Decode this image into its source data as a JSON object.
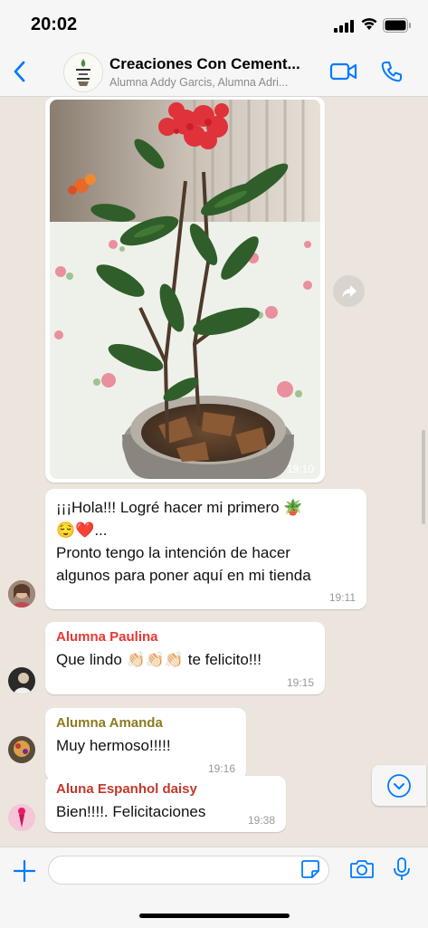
{
  "status_bar": {
    "time": "20:02"
  },
  "header": {
    "group_name": "Creaciones Con Cement...",
    "participants": "Alumna Addy Garcis, Alumna Adri...",
    "avatar_text": "Creaciones con cemento"
  },
  "messages": [
    {
      "type": "image",
      "time": "19:10"
    },
    {
      "type": "text",
      "line1": "¡¡¡Hola!!!  Logré hacer mi primero 🪴",
      "line2": "😌❤️...",
      "line3": "Pronto tengo la intención de hacer",
      "line4": "algunos para poner aquí en mi tienda",
      "time": "19:11"
    },
    {
      "type": "text",
      "sender": "Alumna Paulina",
      "sender_color": "#e53935",
      "text": "Que lindo 👏🏻👏🏻👏🏻 te felicito!!!",
      "time": "19:15"
    },
    {
      "type": "text",
      "sender": "Alumna Amanda",
      "sender_color": "#8d7b1f",
      "text": "Muy hermoso!!!!!",
      "time": "19:16"
    },
    {
      "type": "text",
      "sender": "Aluna Espanhol daisy",
      "sender_color": "#c0392b",
      "text": "Bien!!!!. Felicitaciones",
      "time": "19:38"
    }
  ],
  "input": {
    "placeholder": ""
  },
  "colors": {
    "accent": "#007aff",
    "chat_bg": "#ece5dd",
    "header_bg": "#f6f6f6"
  }
}
